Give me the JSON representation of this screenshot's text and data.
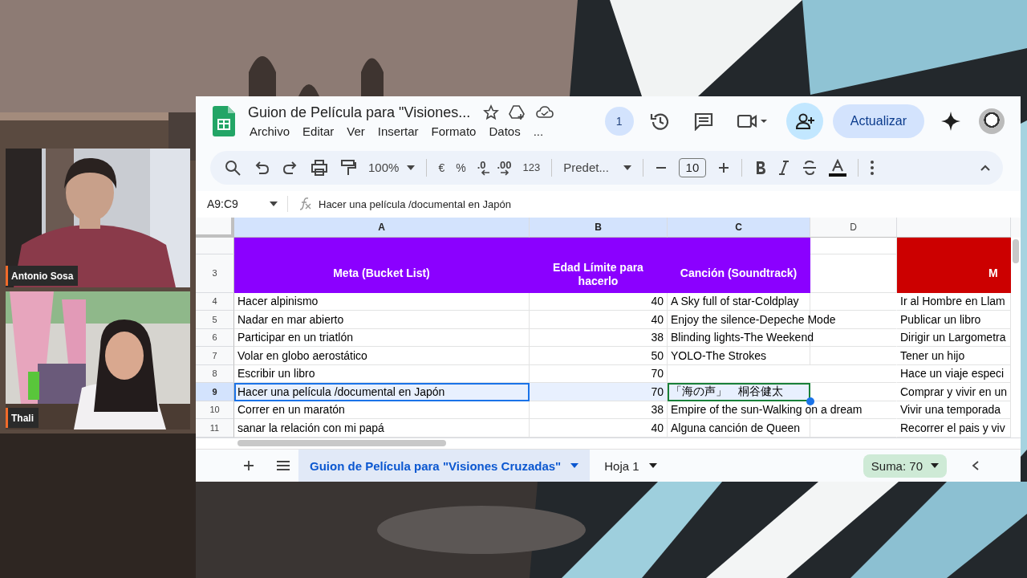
{
  "video_call": {
    "participants": [
      {
        "name": "Antonio Sosa"
      },
      {
        "name": "Thali"
      }
    ]
  },
  "spreadsheet": {
    "title": "Guion de Película para \"Visiones...",
    "menu": [
      "Archivo",
      "Editar",
      "Ver",
      "Insertar",
      "Formato",
      "Datos",
      "..."
    ],
    "viewers_badge": "1",
    "share_button": "Actualizar",
    "toolbar": {
      "zoom": "100%",
      "currency": "€",
      "percent": "%",
      "decrease_decimals": ".0",
      "increase_decimals": ".00",
      "number_format": "123",
      "font": "Predet...",
      "font_size": "10"
    },
    "name_box": "A9:C9",
    "formula": "Hacer una película /documental en Japón",
    "columns": [
      {
        "label": "A",
        "selected": true
      },
      {
        "label": "B",
        "selected": true
      },
      {
        "label": "C",
        "selected": true
      },
      {
        "label": "D",
        "selected": false
      }
    ],
    "rows": [
      {
        "number": "3",
        "kind": "header",
        "selected": false,
        "cursor": false,
        "cells": {
          "a": "Meta (Bucket List)",
          "b": "Edad Límite para hacerlo",
          "c": "Canción (Soundtrack)",
          "e": "M"
        }
      },
      {
        "number": "4",
        "kind": "data",
        "selected": false,
        "cursor": false,
        "cells": {
          "a": "Hacer alpinismo",
          "b": "40",
          "c": "A Sky full of star-Coldplay",
          "e": "Ir al Hombre en Llam"
        }
      },
      {
        "number": "5",
        "kind": "data",
        "selected": false,
        "cursor": false,
        "cells": {
          "a": "Nadar en mar abierto",
          "b": "40",
          "c": "Enjoy the silence-Depeche Mode",
          "e": "Publicar un libro"
        }
      },
      {
        "number": "6",
        "kind": "data",
        "selected": false,
        "cursor": false,
        "cells": {
          "a": "Participar en un triatlón",
          "b": "38",
          "c": "Blinding lights-The Weekend",
          "e": "Dirigir un Largometra"
        }
      },
      {
        "number": "7",
        "kind": "data",
        "selected": false,
        "cursor": false,
        "cells": {
          "a": "Volar en globo aerostático",
          "b": "50",
          "c": "YOLO-The Strokes",
          "e": "Tener un hijo"
        }
      },
      {
        "number": "8",
        "kind": "data",
        "selected": false,
        "cursor": false,
        "cells": {
          "a": "Escribir un libro",
          "b": "70",
          "e": "Hace un viaje especi"
        }
      },
      {
        "number": "9",
        "kind": "data",
        "selected": true,
        "cursor": true,
        "cells": {
          "a": "Hacer una película /documental en Japón",
          "b": "70",
          "c": "「海の声」　桐谷健太",
          "e": "Comprar y vivir en un"
        }
      },
      {
        "number": "10",
        "kind": "data",
        "selected": false,
        "cursor": false,
        "cells": {
          "a": "Correr en un maratón",
          "b": "38",
          "c": "Empire of the sun-Walking on a dream",
          "e": "Vivir una temporada"
        }
      },
      {
        "number": "11",
        "kind": "data",
        "selected": false,
        "cursor": false,
        "cells": {
          "a": "sanar la relación con mi papá",
          "b": "40",
          "c": "Alguna canción de Queen",
          "e": "Recorrer el pais y viv"
        }
      }
    ],
    "sheet_tabs": [
      {
        "label": "Guion de Película para \"Visiones Cruzadas\"",
        "selected": true
      },
      {
        "label": "Hoja 1",
        "selected": false
      }
    ],
    "sum": "Suma: 70"
  }
}
